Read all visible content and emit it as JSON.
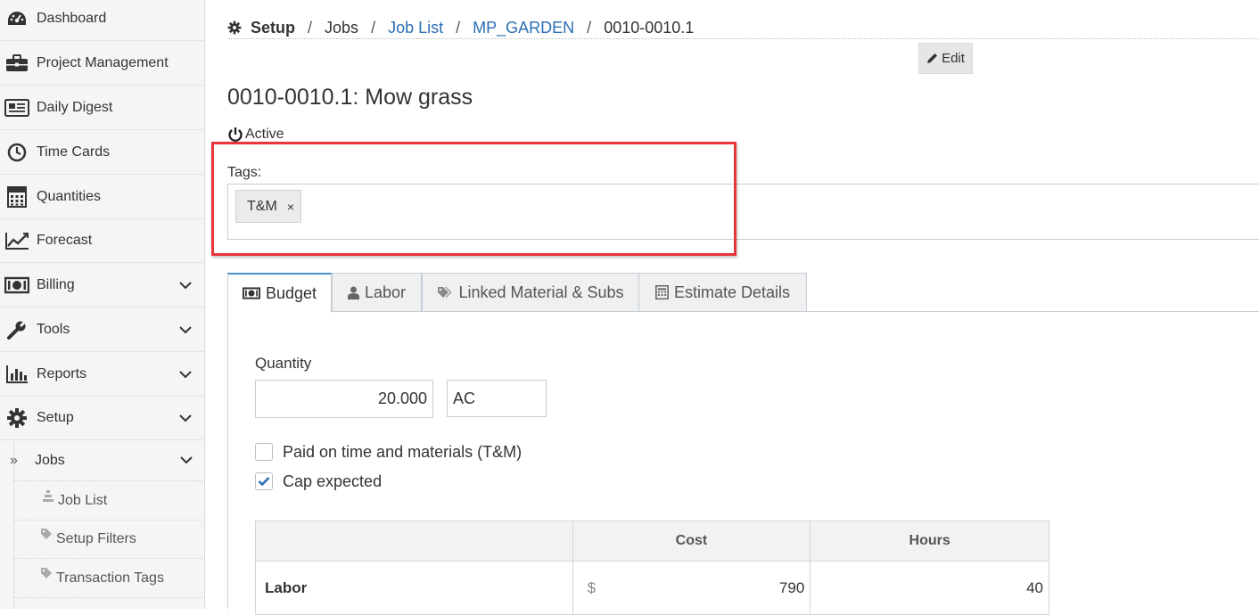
{
  "sidebar": {
    "items": [
      {
        "label": "Dashboard",
        "icon": "dashboard-icon"
      },
      {
        "label": "Project Management",
        "icon": "briefcase-icon"
      },
      {
        "label": "Daily Digest",
        "icon": "newspaper-icon"
      },
      {
        "label": "Time Cards",
        "icon": "clock-icon"
      },
      {
        "label": "Quantities",
        "icon": "calculator-icon"
      },
      {
        "label": "Forecast",
        "icon": "line-chart-icon"
      },
      {
        "label": "Billing",
        "icon": "money-icon",
        "expandable": true
      },
      {
        "label": "Tools",
        "icon": "wrench-icon",
        "expandable": true
      },
      {
        "label": "Reports",
        "icon": "bar-chart-icon",
        "expandable": true
      },
      {
        "label": "Setup",
        "icon": "gear-icon",
        "expandable": true
      }
    ],
    "setup_sub": {
      "jobs_label": "Jobs",
      "jobs_marker": "»",
      "children": [
        {
          "label": "Job List",
          "icon": "list-icon"
        },
        {
          "label": "Setup Filters",
          "icon": "tag-icon"
        },
        {
          "label": "Transaction Tags",
          "icon": "tag-icon"
        }
      ]
    }
  },
  "breadcrumb": {
    "root": "Setup",
    "jobs": "Jobs",
    "job_list": "Job List",
    "project": "MP_GARDEN",
    "current": "0010-0010.1",
    "separator": "/"
  },
  "edit_label": "Edit",
  "title": "0010-0010.1: Mow grass",
  "status": "Active",
  "tags": {
    "label": "Tags:",
    "items": [
      {
        "label": "T&M",
        "remove": "×"
      }
    ]
  },
  "tabs": [
    {
      "label": "Budget",
      "icon": "money-icon",
      "active": true
    },
    {
      "label": "Labor",
      "icon": "user-icon"
    },
    {
      "label": "Linked Material & Subs",
      "icon": "tags-icon"
    },
    {
      "label": "Estimate Details",
      "icon": "calculator-icon"
    }
  ],
  "budget": {
    "quantity_label": "Quantity",
    "quantity_value": "20.000",
    "unit_value": "AC",
    "tm_label": "Paid on time and materials (T&M)",
    "tm_checked": false,
    "cap_label": "Cap expected",
    "cap_checked": true,
    "table": {
      "headers": [
        "",
        "Cost",
        "Hours"
      ],
      "rows": [
        {
          "label": "Labor",
          "currency": "$",
          "cost": "790",
          "hours": "40"
        }
      ]
    }
  },
  "colors": {
    "link": "#2a6eb5",
    "highlight": "#e8363b",
    "checkbox": "#2a6eb5"
  }
}
